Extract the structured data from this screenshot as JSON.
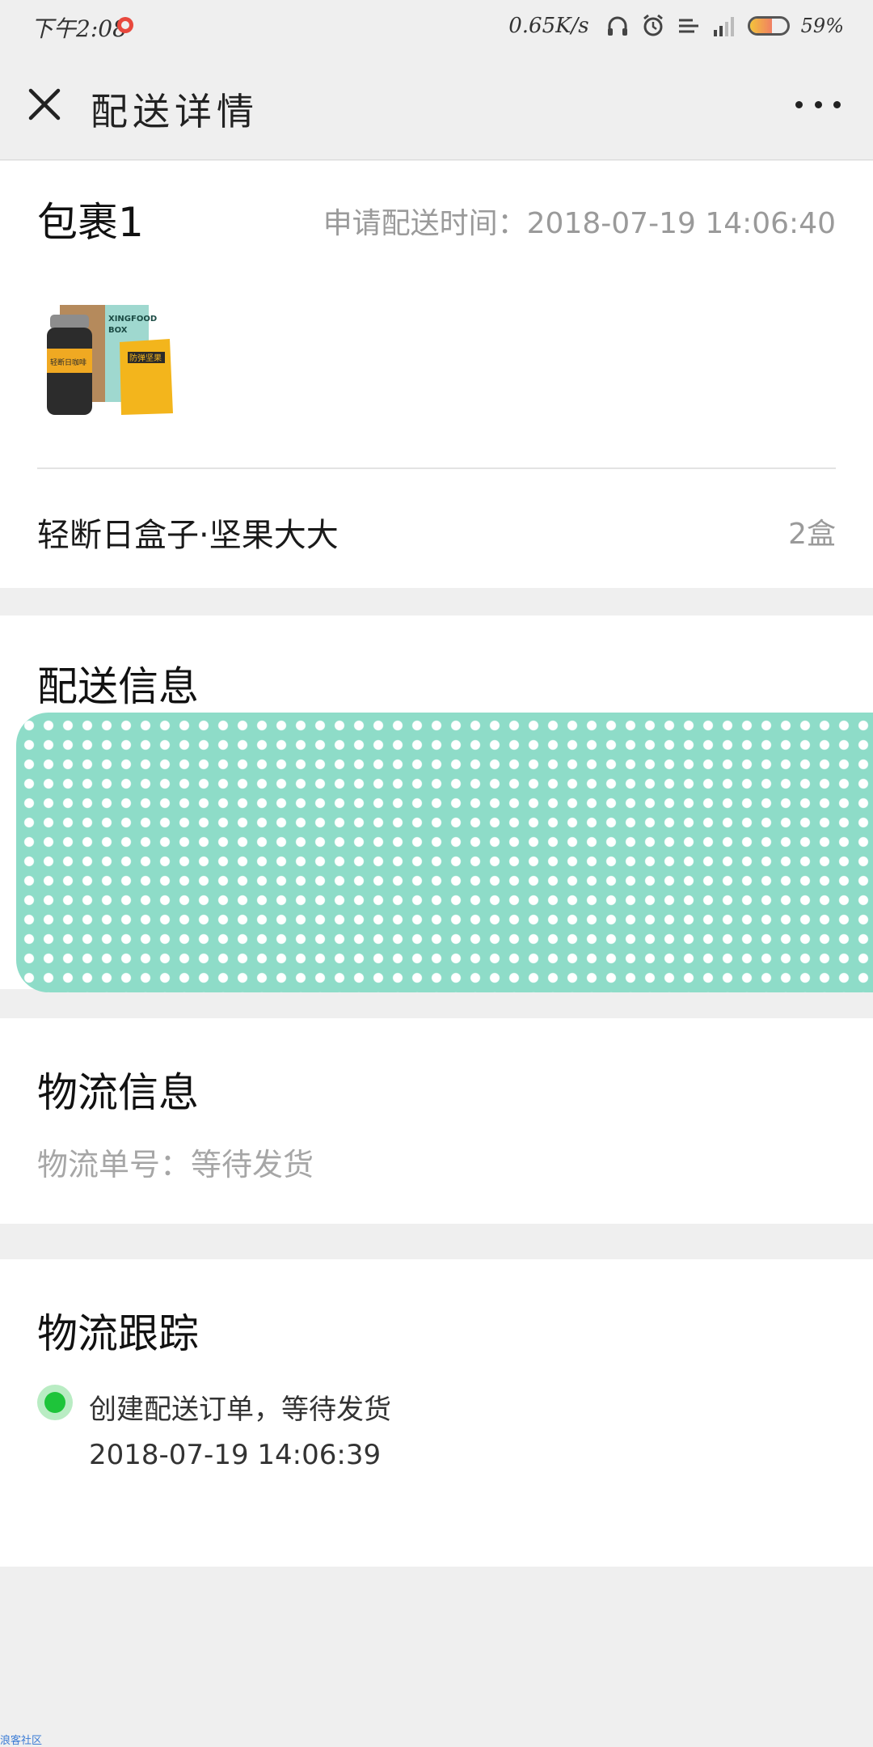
{
  "status_bar": {
    "time": "下午2:08",
    "speed": "0.65K/s",
    "battery_pct": "59%",
    "battery_level": 0.59
  },
  "nav": {
    "title": "配送详情"
  },
  "package": {
    "title": "包裹1",
    "request_time_label": "申请配送时间：",
    "request_time_value": "2018-07-19 14:06:40",
    "image_text": {
      "box_line1": "XINGFOOD",
      "box_line2": "BOX",
      "bottle": "轻断日咖啡",
      "bag": "防弹坚果"
    },
    "item_name": "轻断日盒子·坚果大大",
    "item_qty": "2盒"
  },
  "delivery": {
    "title": "配送信息"
  },
  "logistics": {
    "title": "物流信息",
    "number_label": "物流单号：",
    "number_value": "等待发货"
  },
  "tracking": {
    "title": "物流跟踪",
    "events": [
      {
        "text": "创建配送订单，等待发货",
        "time": "2018-07-19 14:06:39"
      }
    ]
  },
  "watermark": "浪客社区",
  "colors": {
    "accent_green": "#1ec43a",
    "redaction": "#8edcc8",
    "background": "#efefef"
  }
}
